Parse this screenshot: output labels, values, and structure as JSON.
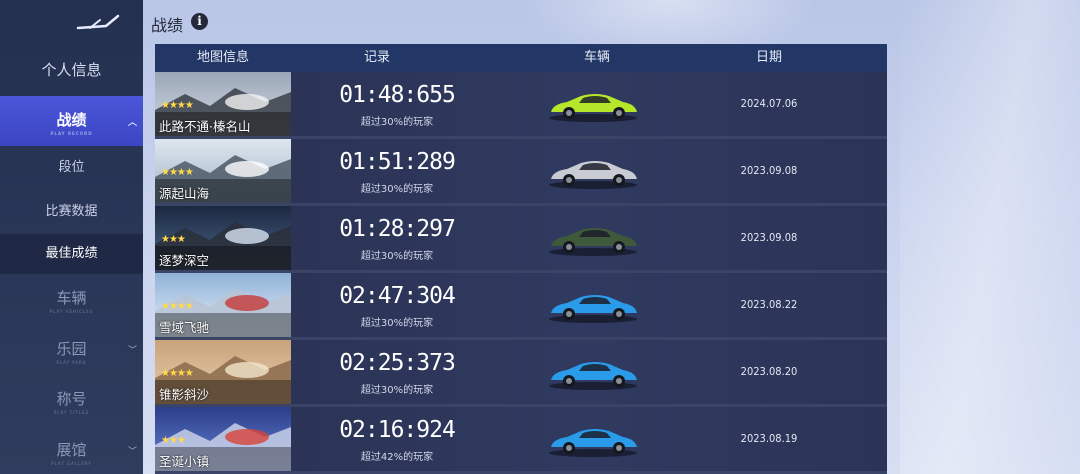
{
  "sidebar": {
    "items": [
      {
        "label": "个人信息"
      },
      {
        "label": "战绩",
        "sub": "PLAY RECORD"
      },
      {
        "label": "车辆",
        "sub": "PLAY VEHICLES"
      },
      {
        "label": "乐园",
        "sub": "PLAY PARK"
      },
      {
        "label": "称号",
        "sub": "PLAY TITLES"
      },
      {
        "label": "展馆",
        "sub": "PLAY GALLERY"
      }
    ],
    "subitems": [
      {
        "label": "段位"
      },
      {
        "label": "比赛数据"
      },
      {
        "label": "最佳成绩"
      }
    ]
  },
  "header": {
    "title": "战绩",
    "info_icon": "i"
  },
  "table": {
    "columns": [
      "地图信息",
      "记录",
      "车辆",
      "日期"
    ],
    "rows": [
      {
        "map": "此路不通·榛名山",
        "stars": "★★★★",
        "time": "01:48:655",
        "beat": "超过30%的玩家",
        "date": "2024.07.06",
        "car_color": "#b6e62a"
      },
      {
        "map": "源起山海",
        "stars": "★★★★",
        "time": "01:51:289",
        "beat": "超过30%的玩家",
        "date": "2023.09.08",
        "car_color": "#c9ccd2"
      },
      {
        "map": "逐梦深空",
        "stars": "★★★",
        "time": "01:28:297",
        "beat": "超过30%的玩家",
        "date": "2023.09.08",
        "car_color": "#3e5a3a"
      },
      {
        "map": "雪域飞驰",
        "stars": "★★★★",
        "time": "02:47:304",
        "beat": "超过30%的玩家",
        "date": "2023.08.22",
        "car_color": "#2a9be8"
      },
      {
        "map": "锥影斜沙",
        "stars": "★★★★",
        "time": "02:25:373",
        "beat": "超过30%的玩家",
        "date": "2023.08.20",
        "car_color": "#2a9be8"
      },
      {
        "map": "圣诞小镇",
        "stars": "★★★",
        "time": "02:16:924",
        "beat": "超过42%的玩家",
        "date": "2023.08.19",
        "car_color": "#2a9be8"
      }
    ]
  }
}
